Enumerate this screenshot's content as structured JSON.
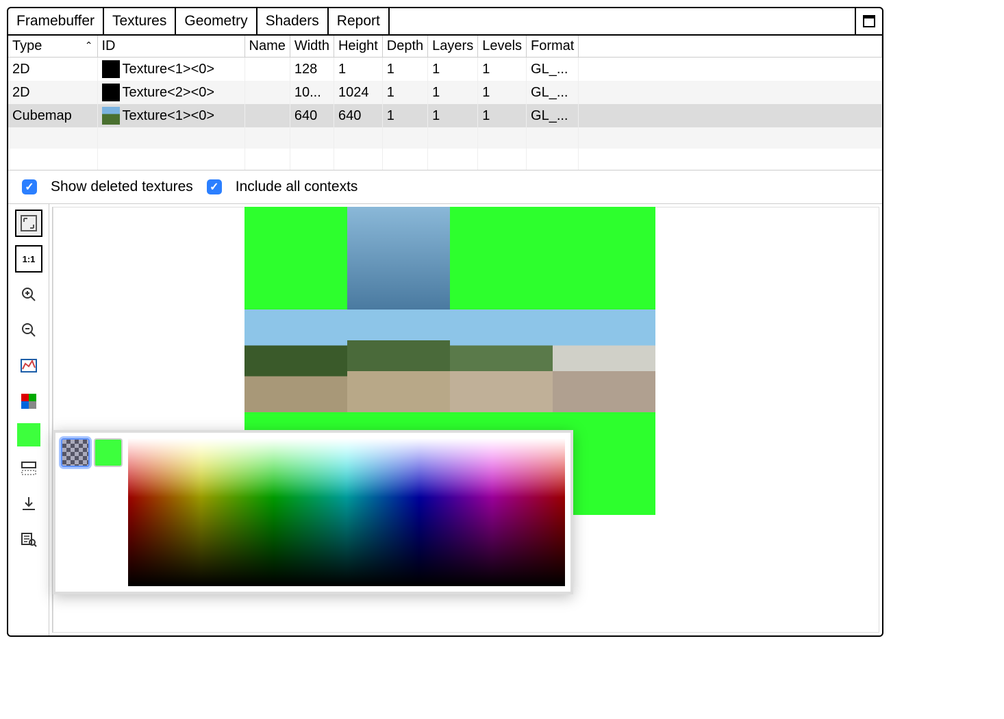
{
  "tabs": {
    "items": [
      "Framebuffer",
      "Textures",
      "Geometry",
      "Shaders",
      "Report"
    ],
    "active_index": 1
  },
  "table": {
    "columns": [
      "Type",
      "ID",
      "Name",
      "Width",
      "Height",
      "Depth",
      "Layers",
      "Levels",
      "Format"
    ],
    "rows": [
      {
        "type": "2D",
        "id": "Texture<1><0>",
        "thumb": "black",
        "name": "",
        "width": "128",
        "height": "1",
        "depth": "1",
        "layers": "1",
        "levels": "1",
        "format": "GL_..."
      },
      {
        "type": "2D",
        "id": "Texture<2><0>",
        "thumb": "black",
        "name": "",
        "width": "10...",
        "height": "1024",
        "depth": "1",
        "layers": "1",
        "levels": "1",
        "format": "GL_..."
      },
      {
        "type": "Cubemap",
        "id": "Texture<1><0>",
        "thumb": "photo",
        "name": "",
        "width": "640",
        "height": "640",
        "depth": "1",
        "layers": "1",
        "levels": "1",
        "format": "GL_..."
      }
    ],
    "selected_index": 2,
    "sort_column": "Type",
    "sort_dir": "asc"
  },
  "options": {
    "show_deleted": {
      "label": "Show deleted textures",
      "checked": true
    },
    "include_all": {
      "label": "Include all contexts",
      "checked": true
    }
  },
  "viewer": {
    "background_color": "#2dff2d",
    "cubemap_faces": {
      "top": "sky",
      "left": "photo1",
      "front": "photo2",
      "right": "photo3",
      "back": "photo4",
      "bottom": "empty"
    }
  },
  "toolbar": {
    "items": [
      {
        "name": "fit-to-window",
        "icon": "fit",
        "active": true
      },
      {
        "name": "zoom-1to1",
        "icon": "1to1"
      },
      {
        "name": "zoom-in",
        "icon": "zoomin"
      },
      {
        "name": "zoom-out",
        "icon": "zoomout"
      },
      {
        "name": "histogram",
        "icon": "histogram"
      },
      {
        "name": "color-channels",
        "icon": "channels"
      },
      {
        "name": "background-color",
        "icon": "bgcolor"
      },
      {
        "name": "flip-vertical",
        "icon": "flip"
      },
      {
        "name": "save-image",
        "icon": "save"
      },
      {
        "name": "inspect-pixel",
        "icon": "inspect"
      }
    ]
  },
  "color_picker": {
    "mode": "checker",
    "current_color": "#3dff3d"
  }
}
